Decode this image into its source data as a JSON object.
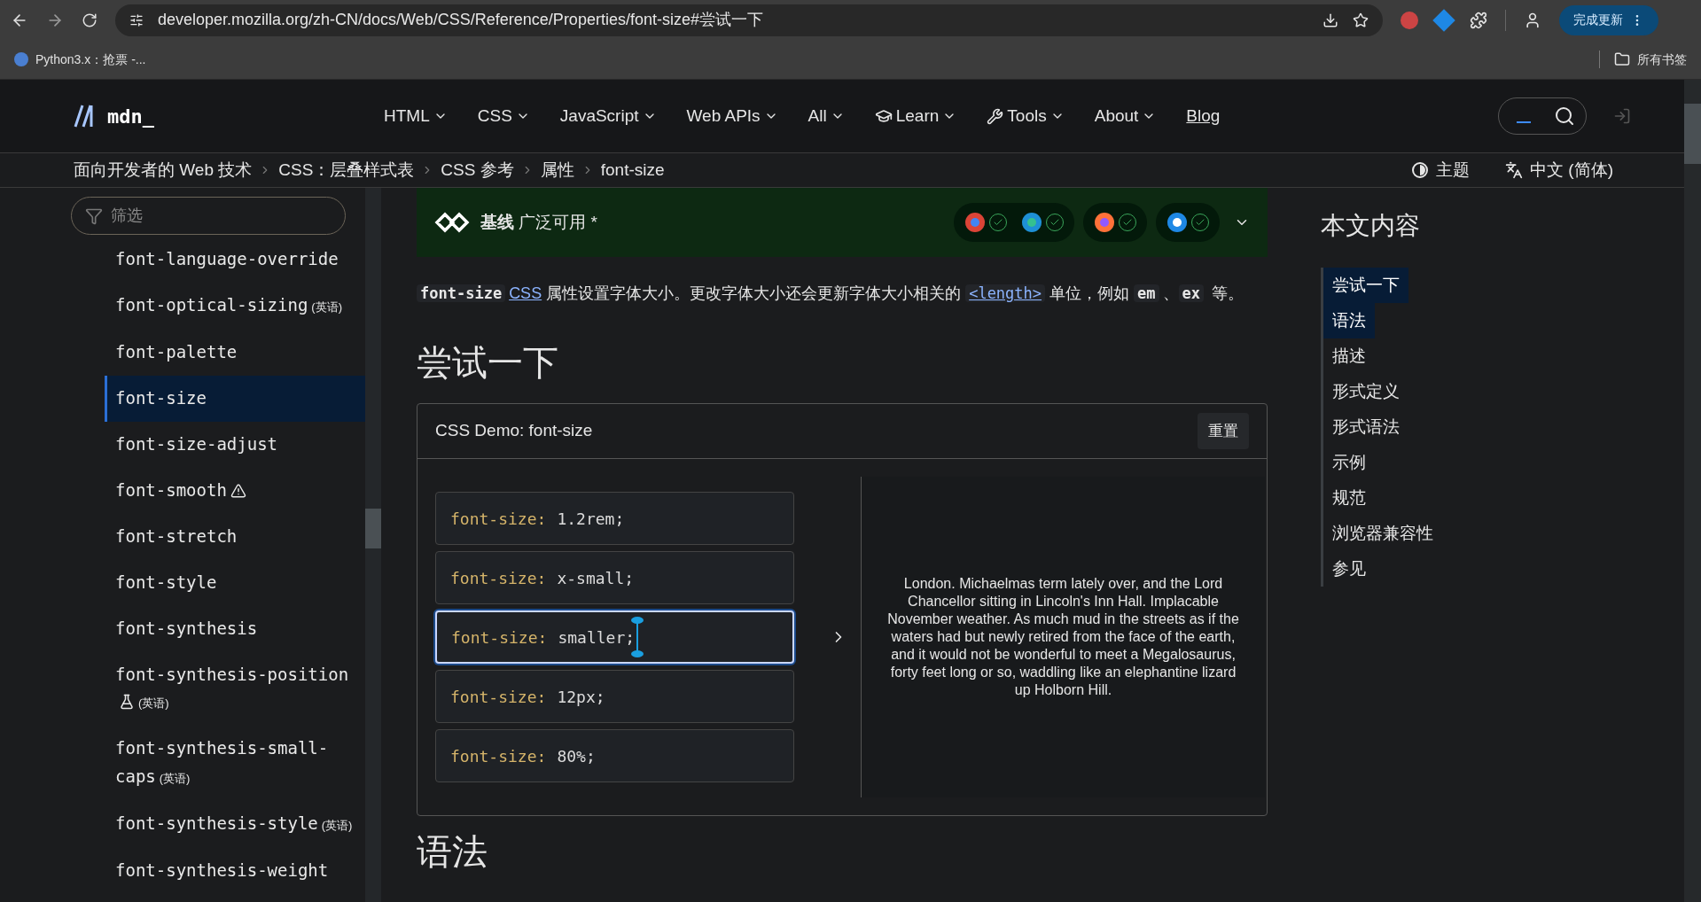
{
  "browser": {
    "url": "developer.mozilla.org/zh-CN/docs/Web/CSS/Reference/Properties/font-size#尝试一下",
    "update_button": "完成更新",
    "bookmarks": [
      {
        "label": "Python3.x：抢票 -..."
      }
    ],
    "all_bookmarks": "所有书签"
  },
  "header": {
    "logo": "mdn_",
    "nav": [
      {
        "label": "HTML",
        "kind": "menu"
      },
      {
        "label": "CSS",
        "kind": "menu"
      },
      {
        "label": "JavaScript",
        "kind": "menu"
      },
      {
        "label": "Web APIs",
        "kind": "menu"
      },
      {
        "label": "All",
        "kind": "menu"
      },
      {
        "label": "Learn",
        "kind": "menu_cap"
      },
      {
        "label": "Tools",
        "kind": "menu_wrench"
      },
      {
        "label": "About",
        "kind": "menu"
      },
      {
        "label": "Blog",
        "kind": "link"
      }
    ]
  },
  "breadcrumbs": [
    "面向开发者的 Web 技术",
    "CSS：层叠样式表",
    "CSS 参考",
    "属性",
    "font-size"
  ],
  "theme_button": "主题",
  "language_button": "中文 (简体)",
  "sidebar": {
    "filter": {
      "placeholder": "筛选"
    },
    "items": [
      {
        "label": "font-language-override",
        "selected": false
      },
      {
        "label": "font-optical-sizing",
        "note": "(英语)",
        "selected": false
      },
      {
        "label": "font-palette",
        "selected": false
      },
      {
        "label": "font-size",
        "selected": true
      },
      {
        "label": "font-size-adjust",
        "selected": false
      },
      {
        "label": "font-smooth",
        "kind": "warning",
        "selected": false
      },
      {
        "label": "font-stretch",
        "selected": false
      },
      {
        "label": "font-style",
        "selected": false
      },
      {
        "label": "font-synthesis",
        "selected": false
      },
      {
        "label": "font-synthesis-position",
        "kind": "experimental",
        "note": "(英语)",
        "selected": false
      },
      {
        "label": "font-synthesis-small-caps",
        "note": "(英语)",
        "selected": false
      },
      {
        "label": "font-synthesis-style",
        "note": "(英语)",
        "selected": false
      },
      {
        "label": "font-synthesis-weight",
        "selected": false
      }
    ]
  },
  "baseline": {
    "text": "**基线** 广泛可用 *",
    "browsers": [
      {
        "kind": "chrome"
      },
      {
        "kind": "edge"
      },
      {
        "kind": "firefox"
      },
      {
        "kind": "safari"
      }
    ]
  },
  "intro": [
    {
      "kind": "code",
      "text": "font-size"
    },
    {
      "kind": "link",
      "text": "CSS"
    },
    {
      "kind": "text",
      "text": " 属性设置字体大小。更改字体大小还会更新字体大小相关的 "
    },
    {
      "kind": "code_link",
      "text": "<length>"
    },
    {
      "kind": "text",
      "text": " 单位，例如 "
    },
    {
      "kind": "code",
      "text": "em"
    },
    {
      "kind": "text",
      "text": "、"
    },
    {
      "kind": "code",
      "text": "ex"
    },
    {
      "kind": "text",
      "text": " 等。"
    }
  ],
  "heading": "尝试一下",
  "demo": {
    "title": "CSS Demo: font-size",
    "reset": "重置",
    "options": [
      {
        "property": "font-size:",
        "value": "1.2rem;",
        "selected": false
      },
      {
        "property": "font-size:",
        "value": "x-small;",
        "selected": false
      },
      {
        "property": "font-size:",
        "value": "smaller;",
        "selected": true
      },
      {
        "property": "font-size:",
        "value": "12px;",
        "selected": false
      },
      {
        "property": "font-size:",
        "value": "80%;",
        "selected": false
      }
    ],
    "output": "London. Michaelmas term lately over, and the Lord Chancellor sitting in Lincoln's Inn Hall. Implacable November weather. As much mud in the streets as if the waters had but newly retired from the face of the earth, and it would not be wonderful to meet a Megalosaurus, forty feet long or so, waddling like an elephantine lizard up Holborn Hill."
  },
  "next_heading": "语法",
  "toc": {
    "title": "本文内容",
    "items": [
      {
        "label": "尝试一下",
        "selected": true
      },
      {
        "label": "语法",
        "selected": true
      },
      {
        "label": "描述",
        "selected": false
      },
      {
        "label": "形式定义",
        "selected": false
      },
      {
        "label": "形式语法",
        "selected": false
      },
      {
        "label": "示例",
        "selected": false
      },
      {
        "label": "规范",
        "selected": false
      },
      {
        "label": "浏览器兼容性",
        "selected": false
      },
      {
        "label": "参见",
        "selected": false
      }
    ]
  }
}
